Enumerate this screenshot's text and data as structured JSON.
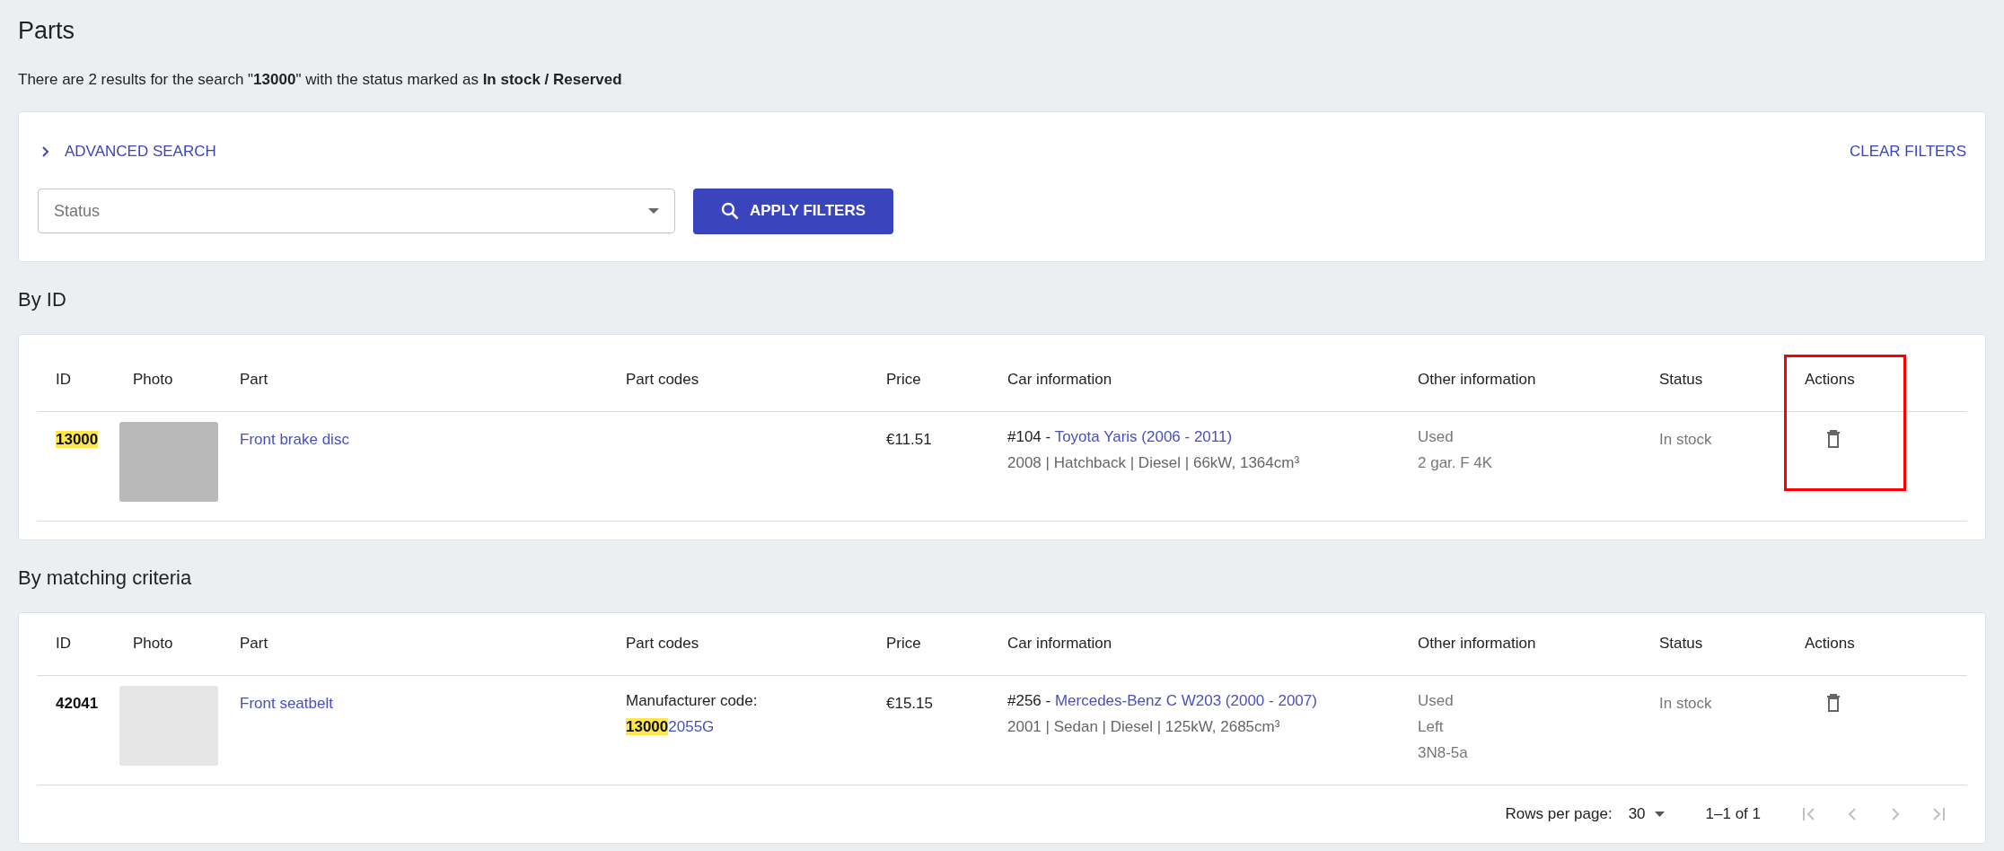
{
  "page_title": "Parts",
  "summary": "There are 2 results for the search \"**13000**\" with the status marked as **In stock / Reserved**",
  "filters": {
    "advanced_search": "ADVANCED SEARCH",
    "expanded": false,
    "clear": "CLEAR FILTERS",
    "status_field": {
      "placeholder": "Status"
    },
    "apply": "APPLY FILTERS"
  },
  "sections": [
    {
      "heading": "By ID",
      "highlight_actions": true,
      "columns": [
        "ID",
        "Photo",
        "Part",
        "Part codes",
        "Price",
        "Car information",
        "Other information",
        "Status",
        "Actions"
      ],
      "rows": [
        {
          "id": "13000",
          "id_match": true,
          "part": "Front brake disc",
          "price": "€11.51",
          "car_ref": "#104 - ",
          "car_model": "Toyota Yaris (2006 - 2011)",
          "car_details": "2008 | Hatchback | Diesel | 66kW, 1364cm³",
          "other": [
            "Used",
            "2 gar. F 4K"
          ],
          "status": "In stock"
        }
      ]
    },
    {
      "heading": "By matching criteria",
      "highlight_actions": false,
      "columns": [
        "ID",
        "Photo",
        "Part",
        "Part codes",
        "Price",
        "Car information",
        "Other information",
        "Status",
        "Actions"
      ],
      "rows": [
        {
          "id": "42041",
          "id_match": false,
          "part": "Front seatbelt",
          "part_codes": {
            "label": "Manufacturer code:",
            "match": "13000",
            "rest": "2055G"
          },
          "price": "€15.15",
          "car_ref": "#256 - ",
          "car_model": "Mercedes-Benz C W203 (2000 - 2007)",
          "car_details": "2001 | Sedan | Diesel | 125kW, 2685cm³",
          "other": [
            "Used",
            "Left",
            "3N8-5a"
          ],
          "status": "In stock"
        }
      ],
      "pagination": {
        "rows_per_page_label": "Rows per page:",
        "rows_per_page": "30",
        "range": "1–1 of 1",
        "first_disabled": true,
        "prev_disabled": true,
        "next_disabled": true,
        "last_disabled": true
      }
    }
  ]
}
